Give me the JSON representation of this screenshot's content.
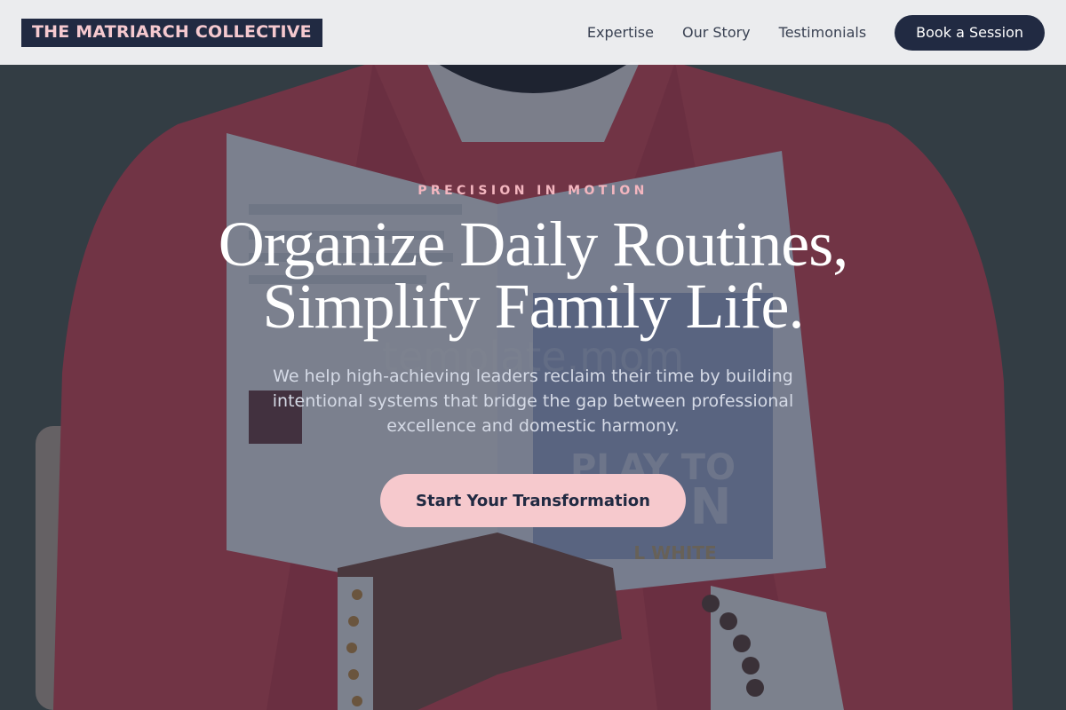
{
  "brand": {
    "logo_text": "THE MATRIARCH COLLECTIVE"
  },
  "nav": {
    "links": [
      "Expertise",
      "Our Story",
      "Testimonials"
    ],
    "cta_label": "Book a Session"
  },
  "hero": {
    "eyebrow": "PRECISION IN MOTION",
    "headline_line1": "Organize Daily Routines,",
    "headline_line2": "Simplify Family Life.",
    "subtext": "We help high-achieving leaders reclaim their time by building intentional systems that bridge the gap between professional excellence and domestic harmony.",
    "cta_label": "Start Your Transformation",
    "background_image": "man-in-red-jacket-reading-book",
    "book_cover_text": [
      "template.mom",
      "PLAY TO",
      "N",
      "L WHITE"
    ]
  },
  "colors": {
    "navy": "#212a42",
    "pink": "#f6c9cd",
    "eyebrow_pink": "#f3b6bf",
    "nav_bg": "#f3f4f6"
  }
}
